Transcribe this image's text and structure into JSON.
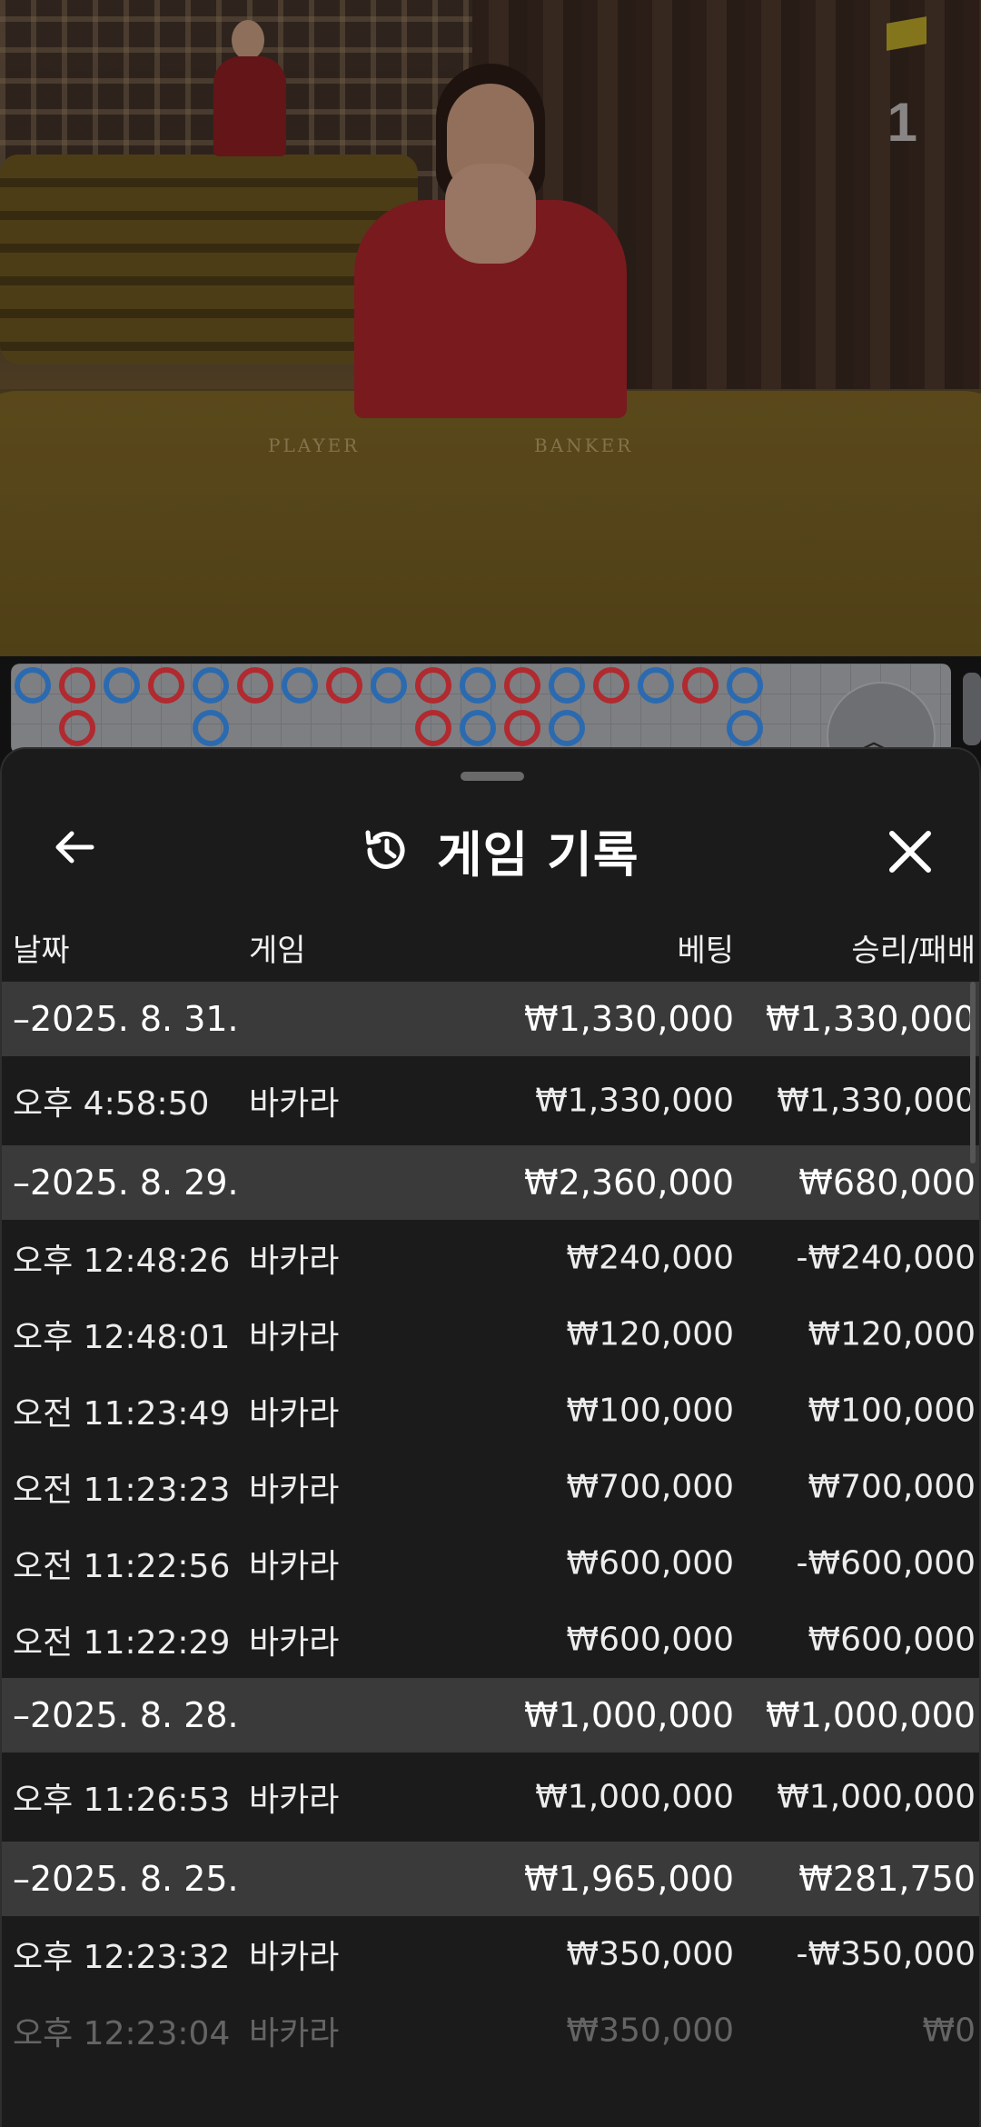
{
  "video": {
    "round_number": "1",
    "felt_player": "PLAYER",
    "felt_banker": "BANKER"
  },
  "roadmap": {
    "beads": [
      {
        "col": 0,
        "row": 0,
        "side": "player"
      },
      {
        "col": 1,
        "row": 0,
        "side": "banker"
      },
      {
        "col": 1,
        "row": 1,
        "side": "banker"
      },
      {
        "col": 2,
        "row": 0,
        "side": "player"
      },
      {
        "col": 3,
        "row": 0,
        "side": "banker"
      },
      {
        "col": 4,
        "row": 0,
        "side": "player"
      },
      {
        "col": 4,
        "row": 1,
        "side": "player"
      },
      {
        "col": 5,
        "row": 0,
        "side": "banker"
      },
      {
        "col": 6,
        "row": 0,
        "side": "player"
      },
      {
        "col": 7,
        "row": 0,
        "side": "banker"
      },
      {
        "col": 8,
        "row": 0,
        "side": "player"
      },
      {
        "col": 9,
        "row": 0,
        "side": "banker"
      },
      {
        "col": 9,
        "row": 1,
        "side": "banker"
      },
      {
        "col": 10,
        "row": 0,
        "side": "player"
      },
      {
        "col": 10,
        "row": 1,
        "side": "player"
      },
      {
        "col": 11,
        "row": 0,
        "side": "banker"
      },
      {
        "col": 11,
        "row": 1,
        "side": "banker"
      },
      {
        "col": 12,
        "row": 0,
        "side": "player"
      },
      {
        "col": 12,
        "row": 1,
        "side": "player"
      },
      {
        "col": 13,
        "row": 0,
        "side": "banker"
      },
      {
        "col": 14,
        "row": 0,
        "side": "player"
      },
      {
        "col": 15,
        "row": 0,
        "side": "banker"
      },
      {
        "col": 16,
        "row": 0,
        "side": "player"
      },
      {
        "col": 16,
        "row": 1,
        "side": "player"
      }
    ]
  },
  "sheet": {
    "title": "게임 기록",
    "columns": {
      "date": "날짜",
      "game": "게임",
      "bet": "베팅",
      "result": "승리/패배"
    },
    "rows": [
      {
        "type": "group",
        "date": "–2025. 8. 31.",
        "game": "",
        "bet": "₩1,330,000",
        "result": "₩1,330,000"
      },
      {
        "type": "item",
        "date": "오후 4:58:50",
        "game": "바카라",
        "bet": "₩1,330,000",
        "result": "₩1,330,000"
      },
      {
        "type": "group",
        "date": "–2025. 8. 29.",
        "game": "",
        "bet": "₩2,360,000",
        "result": "₩680,000"
      },
      {
        "type": "item",
        "date": "오후 12:48:26",
        "game": "바카라",
        "bet": "₩240,000",
        "result": "-₩240,000"
      },
      {
        "type": "item",
        "date": "오후 12:48:01",
        "game": "바카라",
        "bet": "₩120,000",
        "result": "₩120,000"
      },
      {
        "type": "item",
        "date": "오전 11:23:49",
        "game": "바카라",
        "bet": "₩100,000",
        "result": "₩100,000"
      },
      {
        "type": "item",
        "date": "오전 11:23:23",
        "game": "바카라",
        "bet": "₩700,000",
        "result": "₩700,000"
      },
      {
        "type": "item",
        "date": "오전 11:22:56",
        "game": "바카라",
        "bet": "₩600,000",
        "result": "-₩600,000"
      },
      {
        "type": "item",
        "date": "오전 11:22:29",
        "game": "바카라",
        "bet": "₩600,000",
        "result": "₩600,000"
      },
      {
        "type": "group",
        "date": "–2025. 8. 28.",
        "game": "",
        "bet": "₩1,000,000",
        "result": "₩1,000,000"
      },
      {
        "type": "item",
        "date": "오후 11:26:53",
        "game": "바카라",
        "bet": "₩1,000,000",
        "result": "₩1,000,000"
      },
      {
        "type": "group",
        "date": "–2025. 8. 25.",
        "game": "",
        "bet": "₩1,965,000",
        "result": "₩281,750"
      },
      {
        "type": "item",
        "date": "오후 12:23:32",
        "game": "바카라",
        "bet": "₩350,000",
        "result": "-₩350,000"
      },
      {
        "type": "item",
        "date": "오후 12:23:04",
        "game": "바카라",
        "bet": "₩350,000",
        "result": "₩0"
      }
    ]
  }
}
